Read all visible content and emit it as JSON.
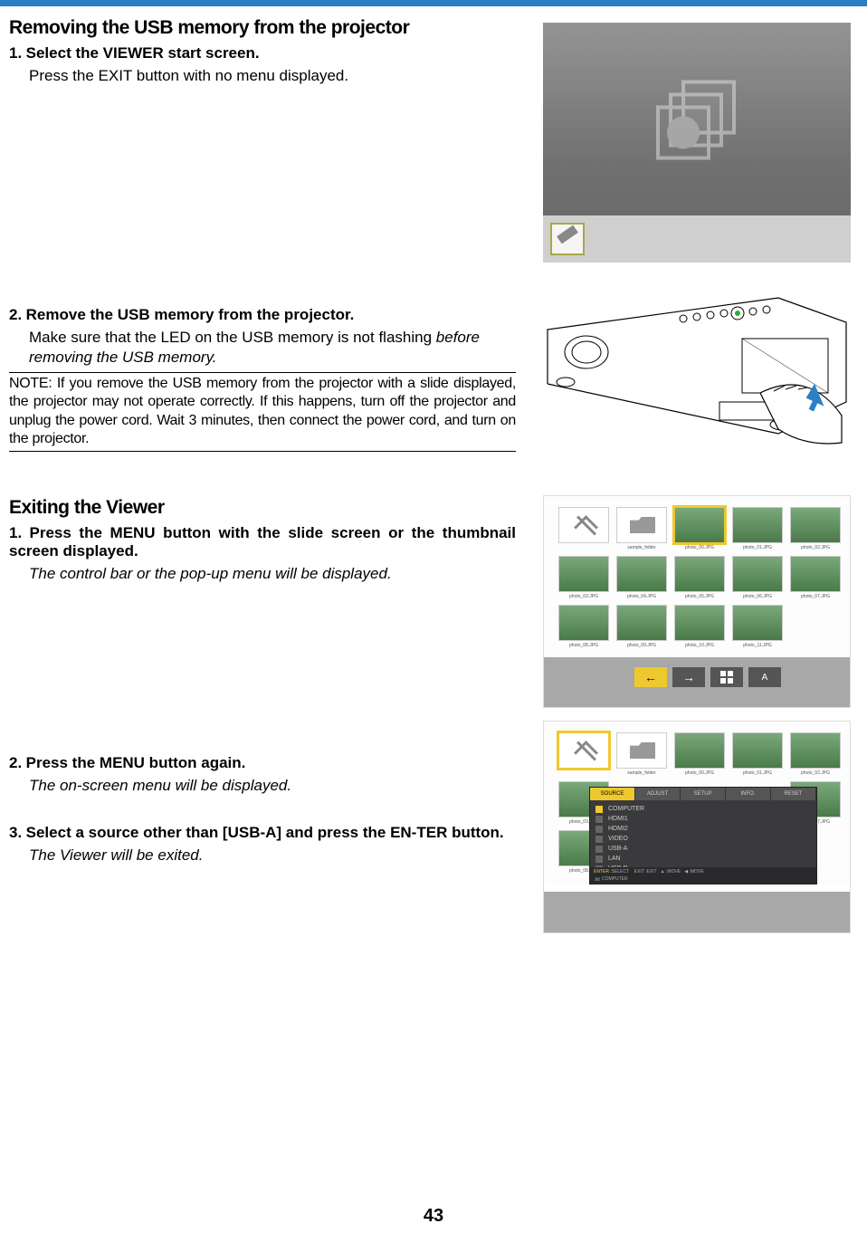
{
  "section1": {
    "heading": "Removing the USB memory from the projector",
    "step1": {
      "num": "1.",
      "title": "Select the VIEWER start screen.",
      "body": "Press the EXIT button with no menu displayed."
    },
    "step2": {
      "num": "2.",
      "title": "Remove the USB memory from the projector.",
      "body_line1": "Make sure that the LED on the USB memory is not flashing",
      "body_line2_italic": "before removing the USB memory."
    },
    "note": "NOTE: If you remove the USB memory from the projector with a slide displayed, the projector may not operate correctly. If this happens, turn off the projector and unplug the power cord. Wait 3 minutes, then connect the power cord, and turn on the projector."
  },
  "section2": {
    "heading": "Exiting the Viewer",
    "step1": {
      "num": "1.",
      "title": "Press the MENU button with the slide screen or the thumbnail screen displayed.",
      "body_italic": "The control bar or the pop-up menu will be displayed."
    },
    "step2": {
      "num": "2.",
      "title": " Press the MENU button again.",
      "body_italic": "The on-screen menu will be displayed."
    },
    "step3": {
      "num": "3.",
      "title": "Select a source other than [USB-A] and press the EN-TER button.",
      "body_italic": "The Viewer will be exited."
    }
  },
  "fig3": {
    "labels": {
      "folder": "sample_folder",
      "p00": "photo_00.JPG",
      "p01": "photo_01.JPG",
      "p02": "photo_02.JPG",
      "p03": "photo_03.JPG",
      "p04": "photo_04.JPG",
      "p05": "photo_05.JPG",
      "p06": "photo_06.JPG",
      "p07": "photo_07.JPG",
      "p08": "photo_08.JPG",
      "p09": "photo_09.JPG",
      "p10": "photo_10.JPG",
      "p11": "photo_11.JPG"
    },
    "ctrl": {
      "back": "←",
      "fwd": "→",
      "az": "A"
    }
  },
  "fig4": {
    "tabs": {
      "source": "SOURCE",
      "adjust": "ADJUST",
      "setup": "SETUP",
      "info": "INFO.",
      "reset": "RESET"
    },
    "items": {
      "computer": "COMPUTER",
      "hdmi1": "HDMI1",
      "hdmi2": "HDMI2",
      "video": "VIDEO",
      "usba": "USB-A",
      "lan": "LAN",
      "usbb": "USB-B"
    },
    "footer": {
      "enter": "ENTER",
      "select": ":SELECT",
      "exit": "EXIT",
      "exitl": ":EXIT",
      "move1": ":MOVE",
      "move2": ":MOVE",
      "src": "COMPUTER"
    }
  },
  "page_number": "43"
}
